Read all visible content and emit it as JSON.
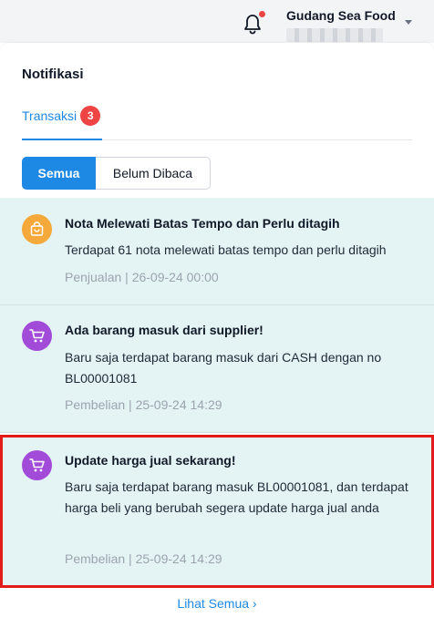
{
  "header": {
    "store_name": "Gudang Sea Food",
    "icons": {
      "bell": "bell-icon",
      "caret": "chevron-down-icon"
    },
    "notification_dot_color": "#ef4444"
  },
  "panel": {
    "title": "Notifikasi",
    "tabs": [
      {
        "label": "Transaksi",
        "badge": "3",
        "active": true
      }
    ],
    "filters": [
      {
        "label": "Semua",
        "active": true
      },
      {
        "label": "Belum Dibaca",
        "active": false
      }
    ],
    "notifications": [
      {
        "icon": "shopping-bag-icon",
        "icon_color": "#f6a93b",
        "title": "Nota Melewati Batas Tempo dan Perlu ditagih",
        "body": "Terdapat 61 nota melewati batas tempo dan perlu ditagih",
        "meta": "Penjualan | 26-09-24 00:00"
      },
      {
        "icon": "shopping-cart-icon",
        "icon_color": "#a24bd8",
        "title": "Ada barang masuk dari supplier!",
        "body": "Baru saja terdapat barang masuk dari CASH dengan no BL00001081",
        "meta": "Pembelian | 25-09-24 14:29"
      },
      {
        "icon": "shopping-cart-icon",
        "icon_color": "#a24bd8",
        "title": "Update harga jual sekarang!",
        "body": "Baru saja terdapat barang masuk BL00001081, dan terdapat harga beli yang berubah segera update harga jual anda",
        "meta": "Pembelian | 25-09-24 14:29"
      }
    ],
    "see_all": "Lihat Semua ›"
  },
  "colors": {
    "primary": "#1e88e5",
    "notification_bg": "#e4f4f4",
    "highlight_border": "#e41b1b"
  }
}
